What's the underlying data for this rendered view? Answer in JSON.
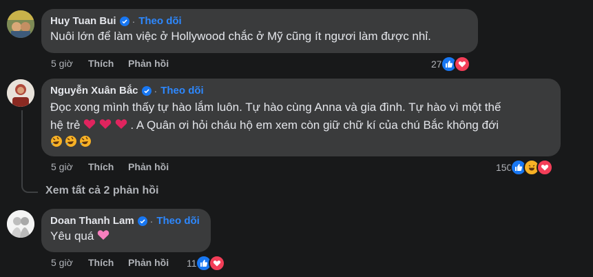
{
  "follow_label": "Theo dõi",
  "separator": "·",
  "comments": [
    {
      "author": "Huy Tuan Bui",
      "text": "Nuôi lớn để làm việc ở Hollywood chắc ở Mỹ cũng ít ngươi làm được nhỉ.",
      "time": "5 giờ",
      "like_label": "Thích",
      "reply_label": "Phản hồi",
      "reaction_count": "27",
      "reactions": [
        "like",
        "love"
      ]
    },
    {
      "author": "Nguyễn Xuân Bắc",
      "text_line1": "Đọc xong mình thấy tự hào lắm luôn. Tự hào cùng Anna và gia đình. Tự hào vì một thế",
      "text_line2a": "hệ trẻ",
      "text_line2b": ". A Quân ơi hỏi cháu hộ em xem còn giữ chữ kí của chú Bắc không đới",
      "time": "5 giờ",
      "like_label": "Thích",
      "reply_label": "Phản hồi",
      "reaction_count": "150",
      "reactions": [
        "like",
        "haha",
        "love"
      ]
    },
    {
      "author": "Doan Thanh Lam",
      "text": "Yêu quá",
      "time": "5 giờ",
      "like_label": "Thích",
      "reply_label": "Phản hồi",
      "reaction_count": "11",
      "reactions": [
        "like",
        "love"
      ]
    }
  ],
  "view_replies": "Xem tất cả 2 phản hồi",
  "colors": {
    "background": "#18191a",
    "bubble": "#3a3b3c",
    "follow": "#2d88ff",
    "like": "#1877f2",
    "love": "#f33e58",
    "haha": "#f7b125"
  }
}
